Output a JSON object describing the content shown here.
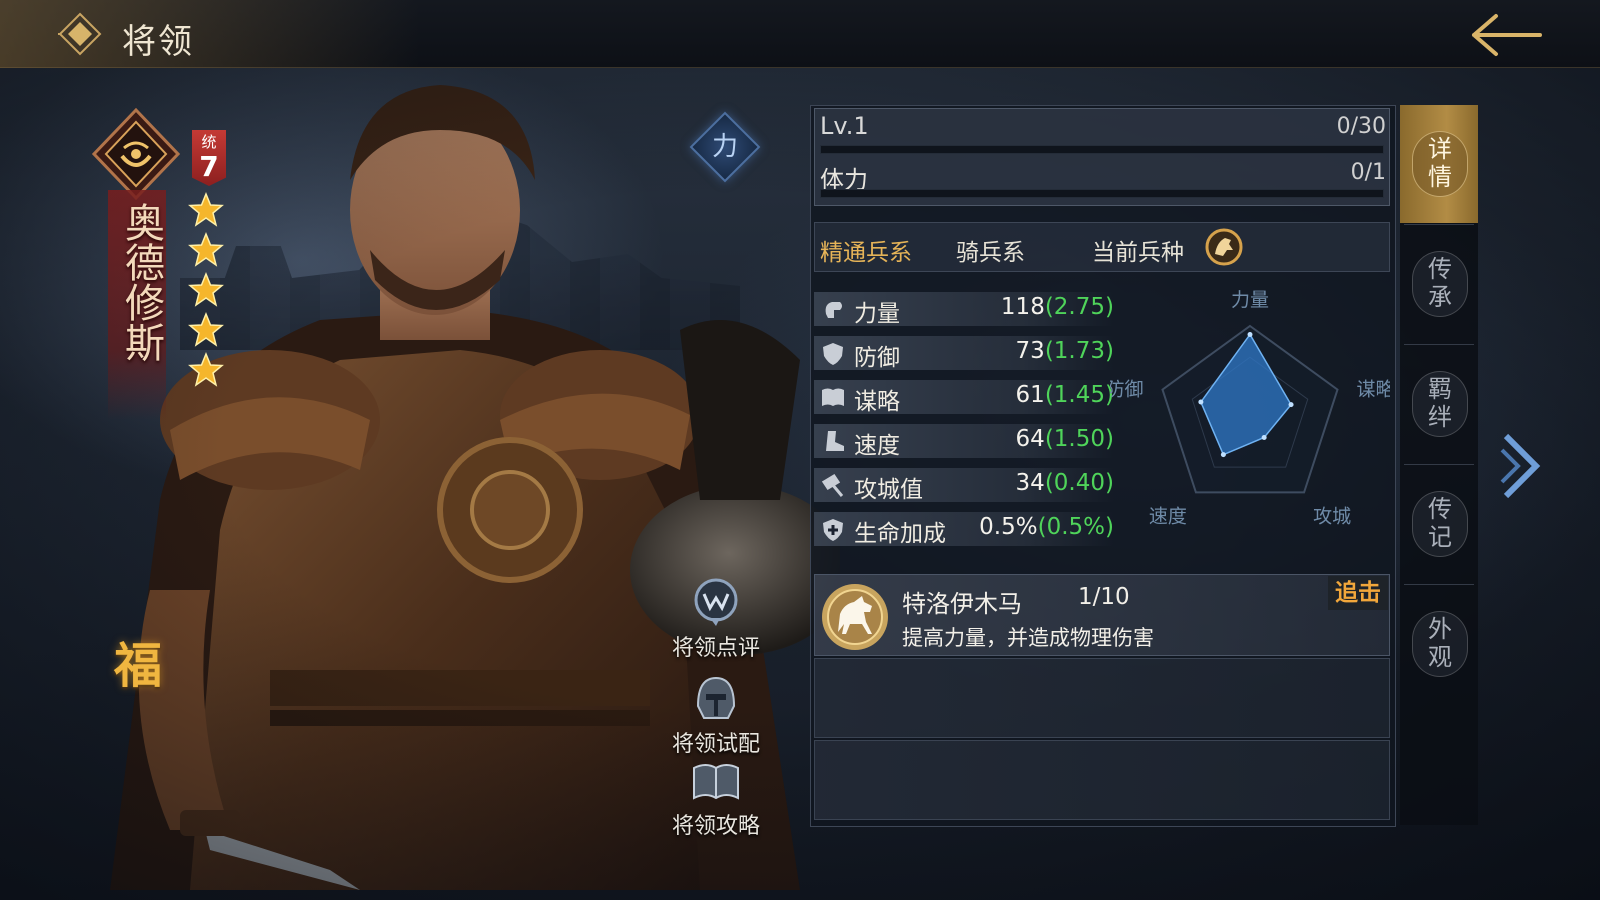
{
  "header": {
    "title": "将领"
  },
  "hero": {
    "name": "奥德修斯",
    "command_label": "统",
    "command_value": "7",
    "stars": 5,
    "fortune": "福",
    "type_label": "力"
  },
  "actions": [
    {
      "label": "将领点评",
      "icon": "comment-icon"
    },
    {
      "label": "将领试配",
      "icon": "helmet-icon"
    },
    {
      "label": "将领攻略",
      "icon": "book-icon"
    }
  ],
  "level": {
    "label": "Lv.1",
    "progress_text": "0/30",
    "progress_fraction": 0
  },
  "stamina": {
    "label": "体力",
    "progress_text": "0/1",
    "progress_fraction": 0
  },
  "troop": {
    "mastery_label": "精通兵系",
    "mastery_value": "骑兵系",
    "current_label": "当前兵种",
    "current_icon": "cavalry-icon"
  },
  "stats": [
    {
      "name": "力量",
      "value": "118",
      "growth": "(2.75)",
      "icon": "fist-icon"
    },
    {
      "name": "防御",
      "value": "73",
      "growth": "(1.73)",
      "icon": "shield-icon"
    },
    {
      "name": "谋略",
      "value": "61",
      "growth": "(1.45)",
      "icon": "book-icon"
    },
    {
      "name": "速度",
      "value": "64",
      "growth": "(1.50)",
      "icon": "boot-icon"
    },
    {
      "name": "攻城值",
      "value": "34",
      "growth": "(0.40)",
      "icon": "hammer-icon"
    },
    {
      "name": "生命加成",
      "value": "0.5%",
      "growth": "(0.5%)",
      "icon": "heart-shield-icon"
    }
  ],
  "radar": {
    "axes": [
      "力量",
      "谋略",
      "攻城",
      "速度",
      "防御"
    ],
    "values": [
      118,
      61,
      34,
      64,
      73
    ],
    "max": 130
  },
  "skill": {
    "name": "特洛伊木马",
    "level": "1/10",
    "description": "提高力量，并造成物理伤害",
    "tag": "追击",
    "icon": "horse-icon"
  },
  "tabs": [
    {
      "label": "详情",
      "active": true
    },
    {
      "label": "传承",
      "active": false
    },
    {
      "label": "羁绊",
      "active": false
    },
    {
      "label": "传记",
      "active": false
    },
    {
      "label": "外观",
      "active": false
    }
  ],
  "colors": {
    "gold": "#e6b458",
    "growth_green": "#4fd45a",
    "tag_orange": "#f2a73b",
    "radar_fill": "#2f78c8"
  }
}
